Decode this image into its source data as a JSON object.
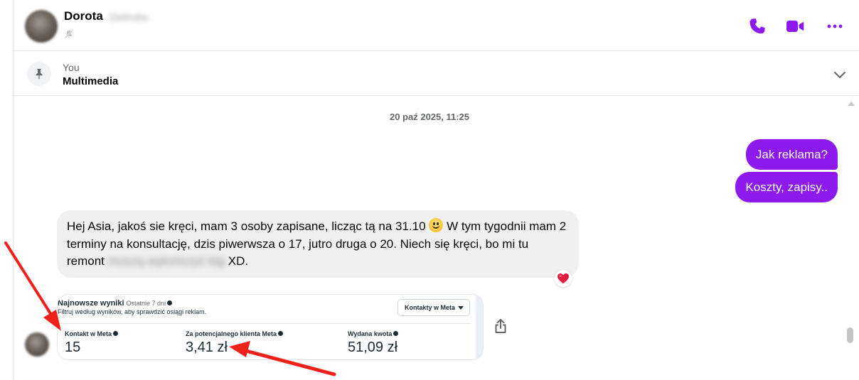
{
  "header": {
    "contact_name": "Dorota",
    "contact_surname_blurred": "Zielinska",
    "icons": [
      "muted-bell-icon",
      "phone-icon",
      "video-camera-icon",
      "more-dots-icon"
    ]
  },
  "pinned": {
    "label": "You",
    "title": "Multimedia"
  },
  "conversation": {
    "timestamp": "20 paź 2025, 11:25",
    "outgoing": [
      "Jak reklama?",
      "Koszty, zapisy.."
    ],
    "incoming": {
      "text_part1": "Hej Asia, jakoś sie kręci, mam 3 osoby zapisane, licząc tą na 31.10",
      "text_part2": "W tym tygodnii mam 2 terminy na konsultację, dzis piwerwsza o 17, jutro druga o 20.  Niech się kręci, bo mi tu remont",
      "text_blurred": "muszą wykończyć łóg",
      "text_end": "XD.",
      "reaction": "heart"
    }
  },
  "screenshot_image": {
    "title": "Najnowsze wyniki",
    "period": "Ostatnie 7 dni",
    "description": "Filtruj według wyników, aby sprawdzić osiągi reklam.",
    "dropdown_value": "Kontakty w Meta",
    "metrics": [
      {
        "label": "Kontakt w Meta",
        "value": "15"
      },
      {
        "label": "Za potencjalnego klienta Meta",
        "value": "3,41 zł"
      },
      {
        "label": "Wydana kwota",
        "value": "51,09 zł"
      }
    ]
  },
  "colors": {
    "accent": "#8e19ee",
    "incoming_bubble": "#f0f0f0",
    "annotation_arrow": "#f0201a"
  }
}
